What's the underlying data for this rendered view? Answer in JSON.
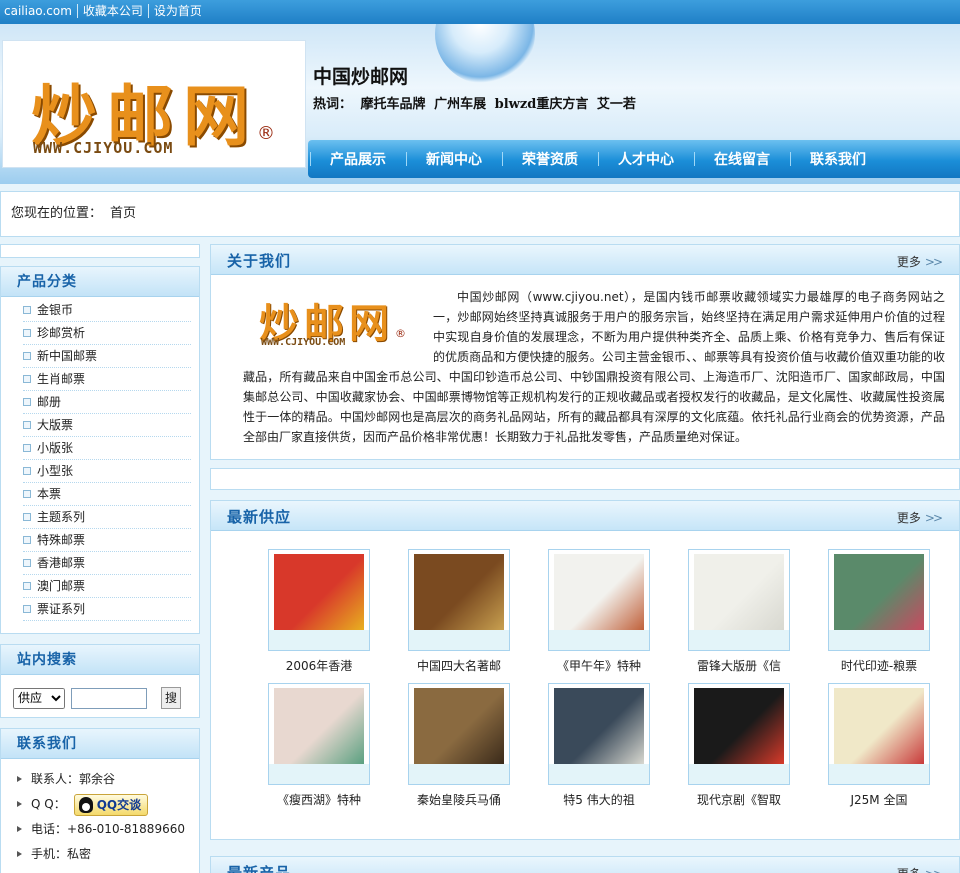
{
  "topbar": {
    "links": [
      "cailiao.com",
      "收藏本公司",
      "设为首页"
    ]
  },
  "header": {
    "logo_text": "炒邮网",
    "logo_url": "WWW.CJIYOU.COM",
    "logo_reg": "®",
    "site_title": "中国炒邮网",
    "hot_label": "热词：",
    "hot_words": [
      "摩托车品牌",
      "广州车展",
      "blwzd重庆方言",
      "艾一若"
    ]
  },
  "nav": {
    "items": [
      "产品展示",
      "新闻中心",
      "荣誉资质",
      "人才中心",
      "在线留言",
      "联系我们"
    ]
  },
  "location": {
    "label": "您现在的位置：",
    "current": "首页"
  },
  "categories": {
    "title": "产品分类",
    "items": [
      "金银币",
      "珍邮赏析",
      "新中国邮票",
      "生肖邮票",
      "邮册",
      "大版票",
      "小版张",
      "小型张",
      "本票",
      "主题系列",
      "特殊邮票",
      "香港邮票",
      "澳门邮票",
      "票证系列"
    ]
  },
  "search": {
    "title": "站内搜索",
    "select_value": "供应",
    "input_value": "",
    "button_label": "搜"
  },
  "contact": {
    "title": "联系我们",
    "person_label": "联系人：",
    "person": "郭余谷",
    "qq_label": "Q Q：",
    "qq_button": "QQ交谈",
    "phone_label": "电话：",
    "phone": "+86-010-81889660",
    "mobile_label": "手机：",
    "mobile": "私密"
  },
  "about": {
    "title": "关于我们",
    "more": "更多",
    "logo_text": "炒邮网",
    "logo_url": "WWW.CJIYOU.COM",
    "logo_reg": "®",
    "text": "中国炒邮网（www.cjiyou.net），是国内钱币邮票收藏领域实力最雄厚的电子商务网站之一，炒邮网始终坚持真诚服务于用户的服务宗旨，始终坚持在满足用户需求延伸用户价值的过程中实现自身价值的发展理念，不断为用户提供种类齐全、品质上乘、价格有竞争力、售后有保证的优质商品和方便快捷的服务。公司主营金银币、、邮票等具有投资价值与收藏价值双重功能的收藏品，所有藏品来自中国金币总公司、中国印钞造币总公司、中钞国鼎投资有限公司、上海造币厂、沈阳造币厂、国家邮政局，中国集邮总公司、中国收藏家协会、中国邮票博物馆等正规机构发行的正规收藏品或者授权发行的收藏品，是文化属性、收藏属性投资属性于一体的精品。中国炒邮网也是高层次的商务礼品网站，所有的藏品都具有深厚的文化底蕴。依托礼品行业商会的优势资源，产品全部由厂家直接供货，因而产品价格非常优惠！长期致力于礼品批发零售，产品质量绝对保证。"
  },
  "supply": {
    "title": "最新供应",
    "more": "更多",
    "products": [
      {
        "name": "2006年香港",
        "colors": [
          "#d8382a",
          "#e8b020"
        ]
      },
      {
        "name": "中国四大名著邮",
        "colors": [
          "#7a4a20",
          "#c8a050"
        ]
      },
      {
        "name": "《甲午年》特种",
        "colors": [
          "#f2f2ee",
          "#c0603a"
        ]
      },
      {
        "name": "雷锋大版册《信",
        "colors": [
          "#f0f0ea",
          "#d8d8d0"
        ]
      },
      {
        "name": "时代印迹-粮票",
        "colors": [
          "#5a8a6a",
          "#c84a60"
        ]
      },
      {
        "name": "《瘦西湖》特种",
        "colors": [
          "#e8d8d0",
          "#5aa080"
        ]
      },
      {
        "name": "秦始皇陵兵马俑",
        "colors": [
          "#8a6a40",
          "#3a2a1a"
        ]
      },
      {
        "name": "特5 伟大的祖",
        "colors": [
          "#3a4a5a",
          "#d8d8d0"
        ]
      },
      {
        "name": "现代京剧《智取",
        "colors": [
          "#1a1a1a",
          "#d83a2a"
        ]
      },
      {
        "name": "J25M 全国",
        "colors": [
          "#f0e8c8",
          "#c83a3a"
        ]
      }
    ]
  },
  "newest": {
    "title": "最新产品",
    "more": "更多"
  }
}
